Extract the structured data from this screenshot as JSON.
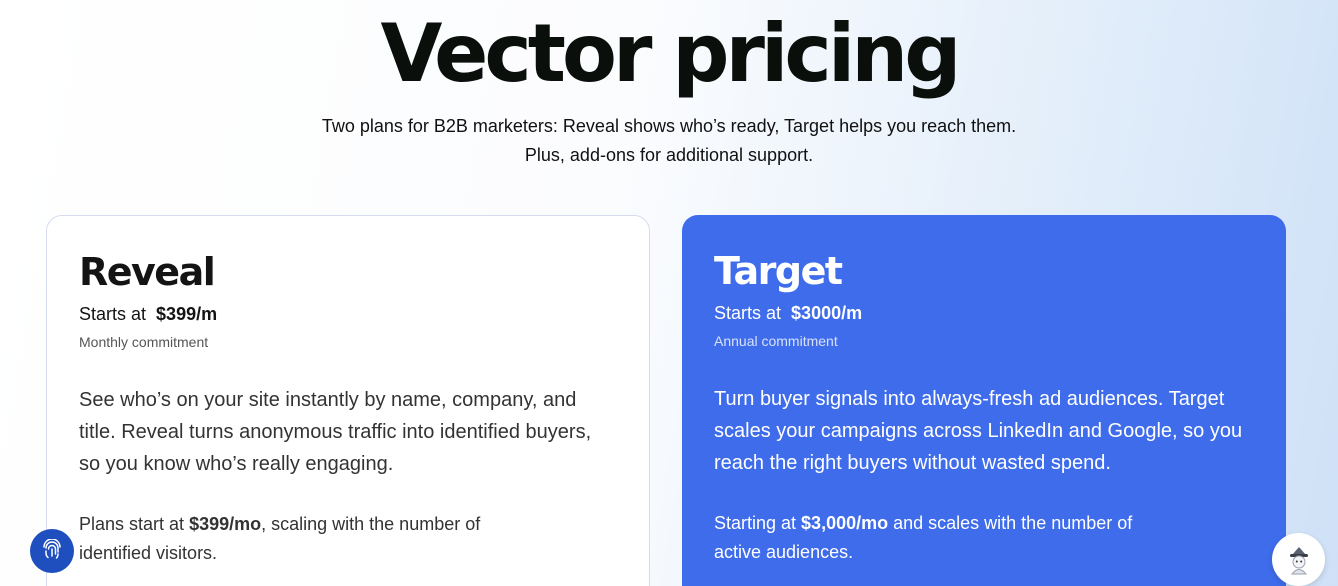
{
  "hero": {
    "title": "Vector pricing",
    "subtitle_line1": "Two plans for B2B marketers: Reveal shows who’s ready, Target helps you reach them.",
    "subtitle_line2": "Plus, add-ons for additional support."
  },
  "plans": {
    "reveal": {
      "name": "Reveal",
      "starts_label": "Starts at",
      "price": "$399/m",
      "commitment": "Monthly commitment",
      "description": "See who’s on your site instantly by name, company, and title. Reveal turns anonymous traffic into identified buyers, so you know who’s really engaging.",
      "note_prefix": "Plans start at ",
      "note_price": "$399/mo",
      "note_suffix": ", scaling with the number of identified visitors."
    },
    "target": {
      "name": "Target",
      "starts_label": "Starts at",
      "price": "$3000/m",
      "commitment": "Annual commitment",
      "description": "Turn buyer signals into always-fresh ad audiences. Target scales your campaigns across LinkedIn and Google, so you reach the right buyers without wasted spend.",
      "note_prefix": "Starting at ",
      "note_price": "$3,000/mo",
      "note_suffix": " and scales with the number of active audiences."
    }
  },
  "widgets": {
    "left_icon": "fingerprint-icon",
    "right_icon": "assistant-avatar-icon"
  },
  "colors": {
    "target_card": "#3f6ceb",
    "fab": "#1f4fbf"
  }
}
